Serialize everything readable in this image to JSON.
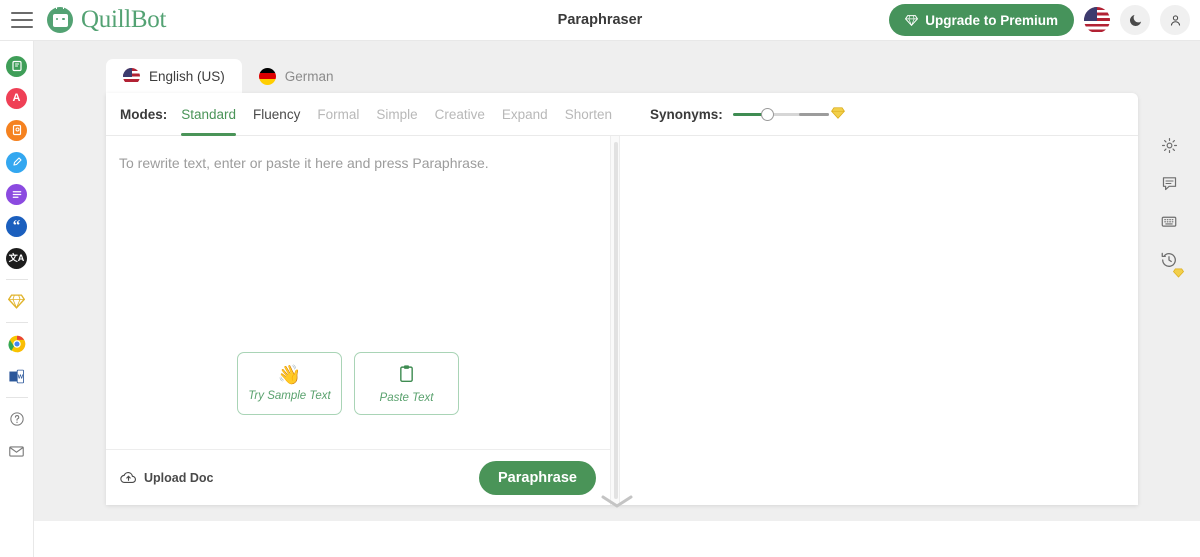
{
  "header": {
    "menu_icon": "hamburger-icon",
    "brand": "QuillBot",
    "title": "Paraphraser",
    "upgrade_label": "Upgrade to Premium",
    "upgrade_icon": "diamond-icon",
    "language_flag": "us-flag-icon",
    "dark_mode_icon": "moon-icon",
    "account_icon": "person-icon",
    "accent_green": "#46935b"
  },
  "sidebar": {
    "items": [
      {
        "name": "paraphraser",
        "glyph": "✎",
        "color": "#3f9e58"
      },
      {
        "name": "grammar-checker",
        "glyph": "A",
        "color": "#ef4056"
      },
      {
        "name": "plagiarism-checker",
        "glyph": "❑",
        "color": "#f58220"
      },
      {
        "name": "co-writer",
        "glyph": "✐",
        "color": "#33a7f0"
      },
      {
        "name": "summarizer",
        "glyph": "☰",
        "color": "#8b4ae0"
      },
      {
        "name": "citation-generator",
        "glyph": "“",
        "color": "#1b5fbe"
      },
      {
        "name": "translator",
        "glyph": "文",
        "color": "#1d1d1d"
      }
    ],
    "premium_item": {
      "name": "premium",
      "glyph": "◆",
      "color": "#e0b32a"
    },
    "extensions": [
      {
        "name": "chrome-extension"
      },
      {
        "name": "word-addin"
      }
    ],
    "footer_items": [
      {
        "name": "help"
      },
      {
        "name": "contact"
      }
    ]
  },
  "tabs": [
    {
      "label": "English (US)",
      "flag": "us-flag-icon",
      "active": true
    },
    {
      "label": "German",
      "flag": "de-flag-icon",
      "active": false
    }
  ],
  "modes": {
    "label": "Modes:",
    "items": [
      {
        "label": "Standard",
        "state": "active"
      },
      {
        "label": "Fluency",
        "state": "available"
      },
      {
        "label": "Formal",
        "state": "locked"
      },
      {
        "label": "Simple",
        "state": "locked"
      },
      {
        "label": "Creative",
        "state": "locked"
      },
      {
        "label": "Expand",
        "state": "locked"
      },
      {
        "label": "Shorten",
        "state": "locked"
      }
    ]
  },
  "synonyms": {
    "label": "Synonyms:",
    "value": 25,
    "max_icon": "diamond-icon"
  },
  "editor": {
    "placeholder": "To rewrite text, enter or paste it here and press Paraphrase.",
    "sample_buttons": [
      {
        "label": "Try Sample Text",
        "glyph": "👋",
        "name": "try-sample-text"
      },
      {
        "label": "Paste Text",
        "glyph": "📋",
        "name": "paste-text"
      }
    ],
    "upload_label": "Upload Doc",
    "upload_icon": "cloud-upload-icon",
    "paraphrase_label": "Paraphrase"
  },
  "right_toolbar": [
    {
      "name": "settings",
      "icon": "gear-icon"
    },
    {
      "name": "feedback",
      "icon": "comment-icon"
    },
    {
      "name": "shortcuts",
      "icon": "keyboard-icon"
    },
    {
      "name": "history",
      "icon": "history-icon",
      "badge": "diamond-icon"
    }
  ],
  "expand_chevron": "chevron-down-icon"
}
